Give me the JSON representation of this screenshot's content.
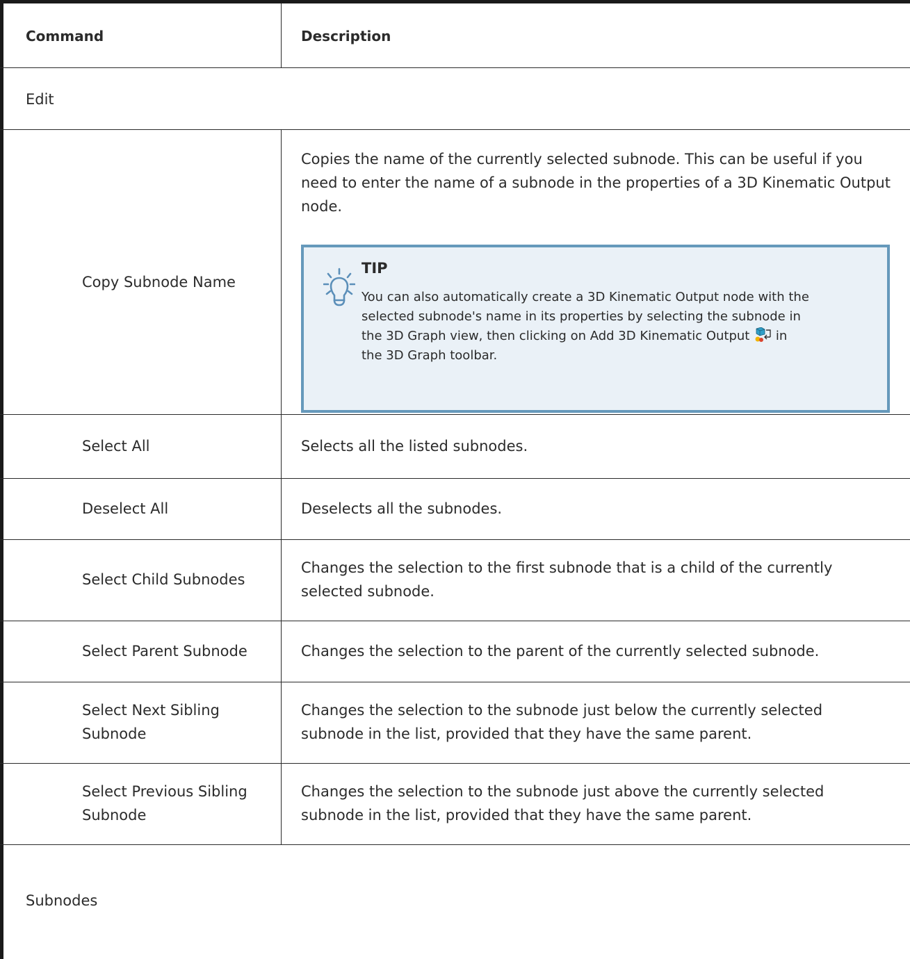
{
  "table": {
    "headers": {
      "command": "Command",
      "description": "Description"
    },
    "sections": [
      {
        "name": "Edit",
        "rows": [
          {
            "command": [
              "Copy Subnode Name"
            ],
            "description": [
              "Copies the name of the currently selected subnode. This can be useful if you",
              "need to enter the name of a subnode in the properties of a 3D Kinematic Output",
              "node."
            ],
            "tip": {
              "title": "TIP",
              "lines": [
                "You can also automatically create a 3D Kinematic Output node with the",
                "selected subnode's name in its properties by selecting the subnode in",
                "the 3D Graph view, then clicking on Add 3D Kinematic Output",
                "the 3D Graph toolbar."
              ],
              "after_icon": "in",
              "icon": "add-3d-kinematic-output-icon"
            }
          },
          {
            "command": [
              "Select All"
            ],
            "description": [
              "Selects all the listed subnodes."
            ]
          },
          {
            "command": [
              "Deselect All"
            ],
            "description": [
              "Deselects all the subnodes."
            ]
          },
          {
            "command": [
              "Select Child Subnodes"
            ],
            "description": [
              "Changes the selection to the first subnode that is a child of the currently",
              "selected subnode."
            ]
          },
          {
            "command": [
              "Select Parent Subnode"
            ],
            "description": [
              "Changes the selection to the parent of the currently selected subnode."
            ]
          },
          {
            "command": [
              "Select Next Sibling",
              "Subnode"
            ],
            "description": [
              "Changes the selection to the subnode just below the currently selected",
              "subnode in the list, provided that they have the same parent."
            ]
          },
          {
            "command": [
              "Select Previous Sibling",
              "Subnode"
            ],
            "description": [
              "Changes the selection to the subnode just above the currently selected",
              "subnode in the list, provided that they have the same parent."
            ]
          }
        ]
      },
      {
        "name": "Subnodes",
        "rows": []
      }
    ]
  },
  "colors": {
    "border": "#1a1a1a",
    "tip_border": "#6699bb",
    "tip_bg": "#eaf1f7",
    "text": "#2b2b2b"
  }
}
